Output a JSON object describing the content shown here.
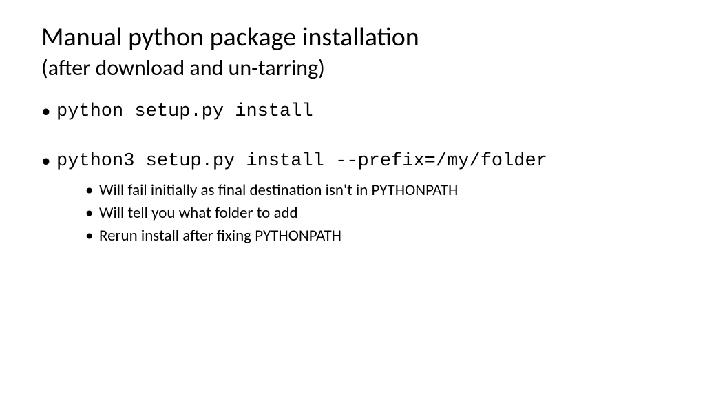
{
  "title": "Manual python package installation",
  "subtitle": "(after download and un-tarring)",
  "bullets": [
    {
      "text": "python setup.py install",
      "children": []
    },
    {
      "text": "python3 setup.py install --prefix=/my/folder",
      "children": [
        "Will fail initially as final destination isn't in PYTHONPATH",
        "Will tell you what folder to add",
        "Rerun install after fixing PYTHONPATH"
      ]
    }
  ]
}
